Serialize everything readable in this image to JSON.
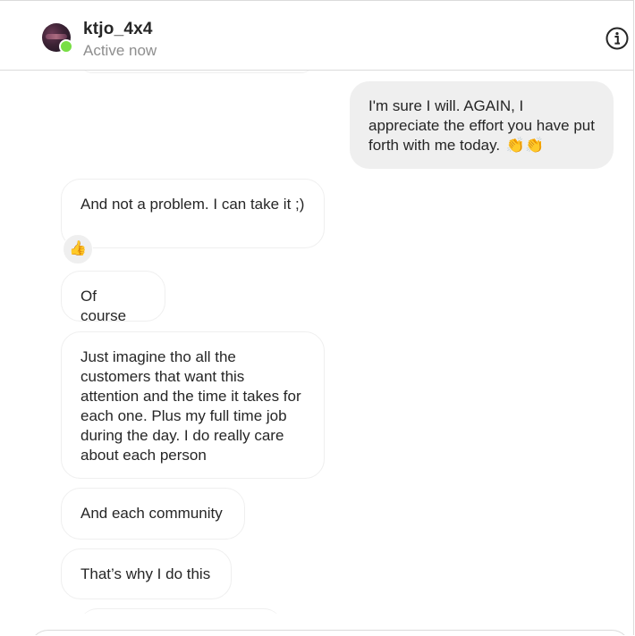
{
  "header": {
    "username": "ktjo_4x4",
    "status": "Active now",
    "info_icon": "info-icon"
  },
  "messages": [
    {
      "id": "m1",
      "direction": "outgoing",
      "text": "I'm sure I will. AGAIN, I appreciate the effort you have put forth with me today.",
      "emoji": "👏👏"
    },
    {
      "id": "m2",
      "direction": "incoming",
      "text": "And not a problem. I can take it ;)",
      "reaction": "👍"
    },
    {
      "id": "m3",
      "direction": "incoming",
      "text": "Of course"
    },
    {
      "id": "m4",
      "direction": "incoming",
      "text": "Just imagine tho all the customers that want this attention and the time it takes for each one. Plus my full time job during the day. I do really care about each person"
    },
    {
      "id": "m5",
      "direction": "incoming",
      "text": "And each community"
    },
    {
      "id": "m6",
      "direction": "incoming",
      "text": "That’s why I do this"
    }
  ],
  "colors": {
    "outgoing_bubble": "#efefef",
    "incoming_border": "#efefef",
    "online_dot": "#78de45",
    "status_text": "#8e8e8e",
    "divider": "#dbdbdb"
  }
}
